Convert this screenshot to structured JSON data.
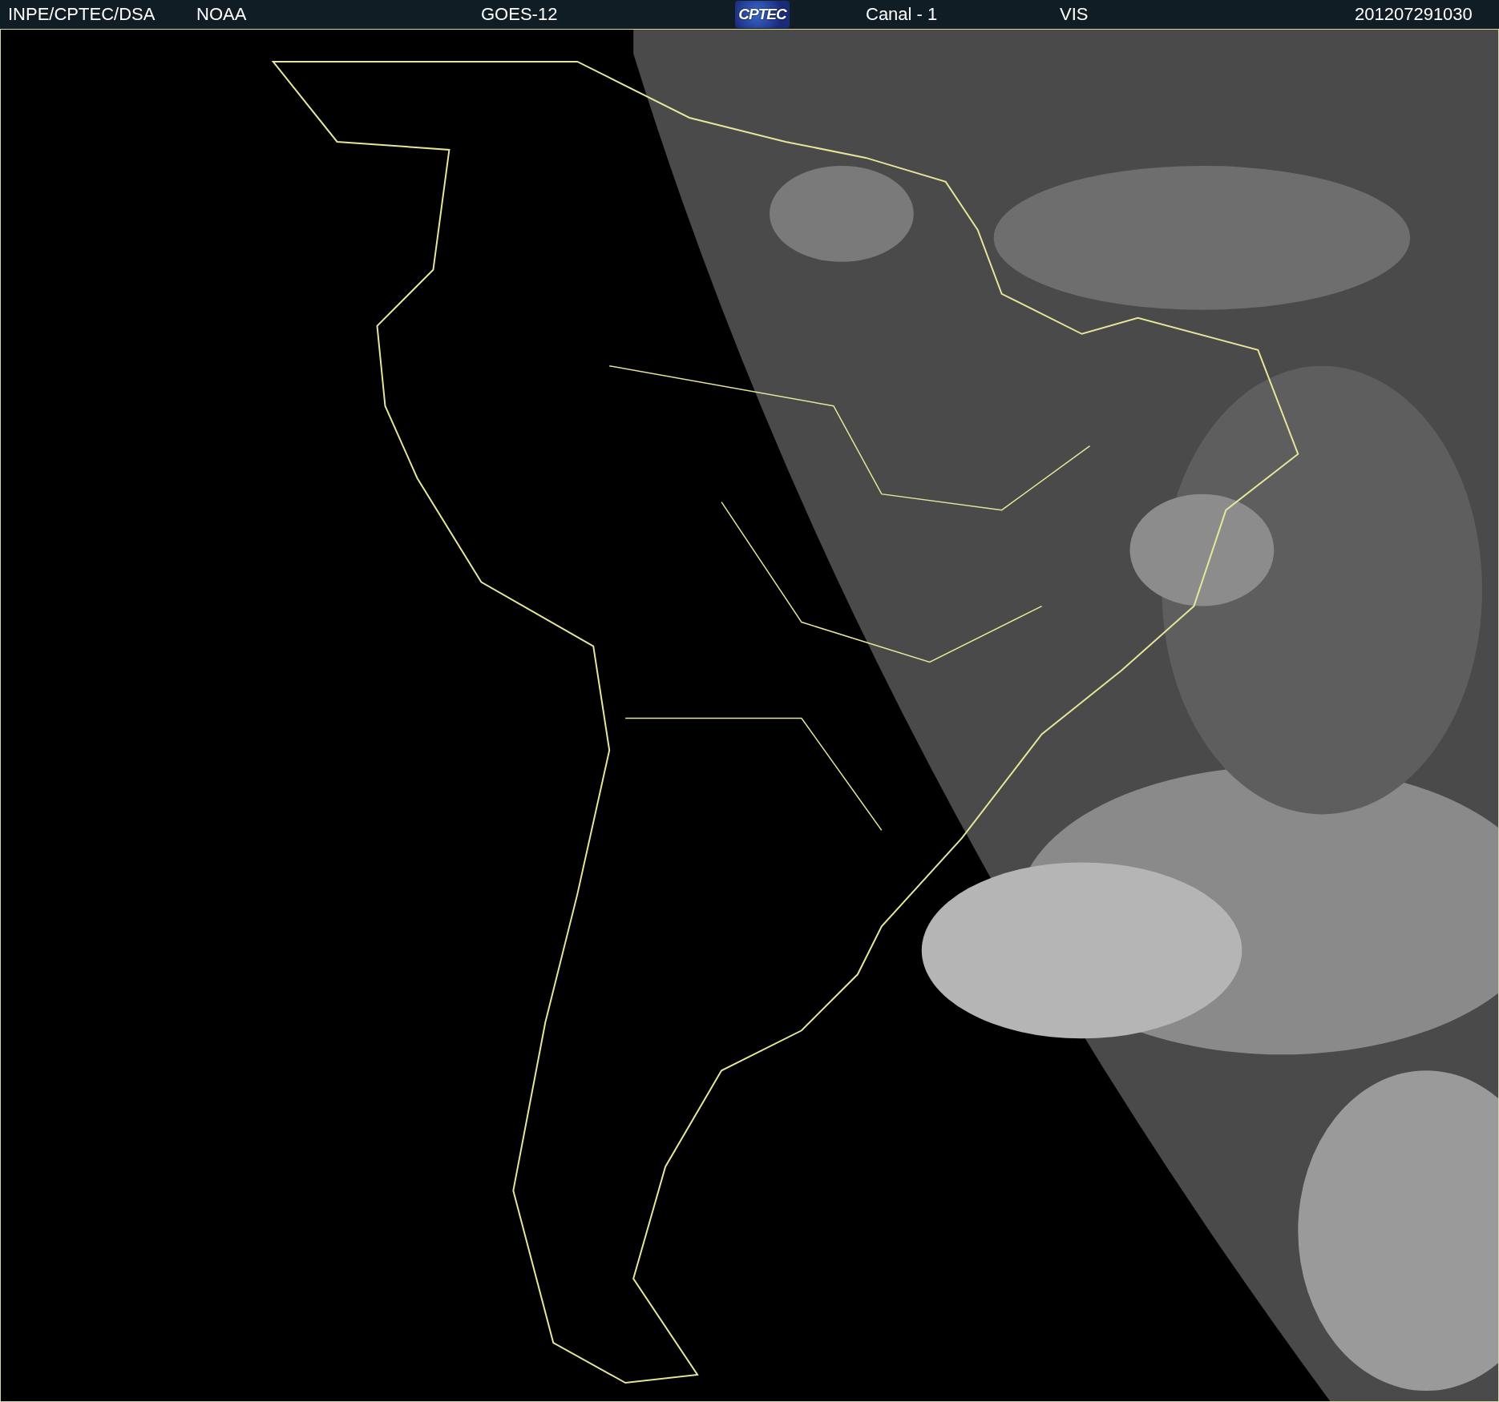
{
  "header": {
    "source": "INPE/CPTEC/DSA",
    "agency": "NOAA",
    "satellite": "GOES-12",
    "logo": "CPTEC",
    "channel": "Canal - 1",
    "band": "VIS",
    "timestamp": "201207291030"
  }
}
